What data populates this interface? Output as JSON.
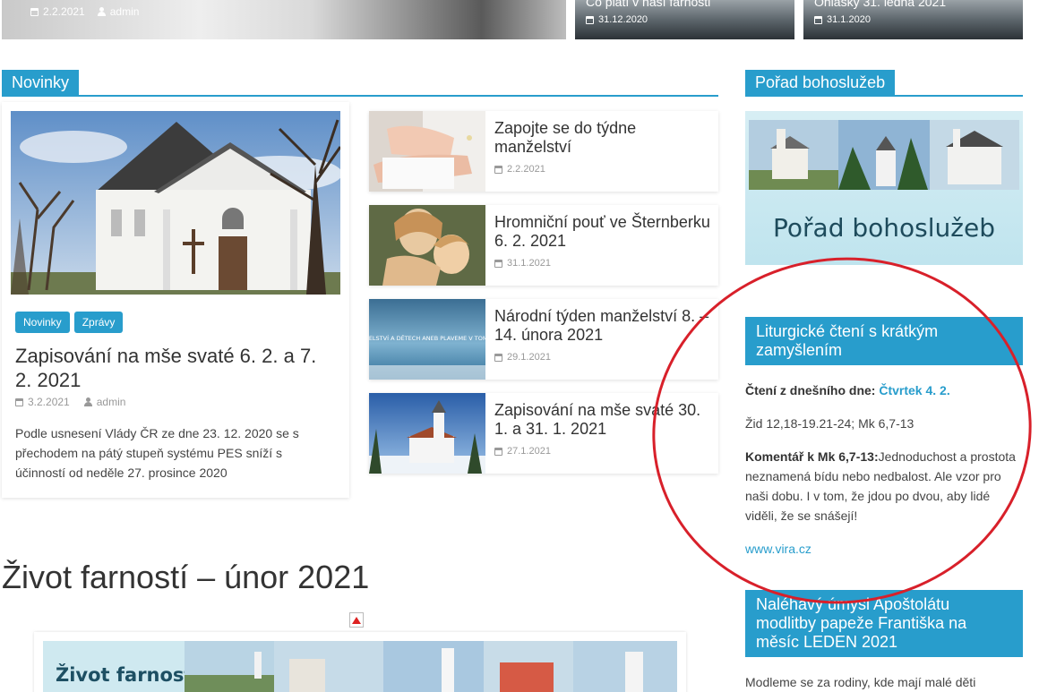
{
  "top_strip": {
    "hero": {
      "date": "2.2.2021",
      "author": "admin"
    },
    "cards": [
      {
        "title": "Co platí v naší farnosti",
        "date": "31.12.2020"
      },
      {
        "title": "Ohlášky 31. ledna 2021",
        "date": "31.1.2020"
      }
    ]
  },
  "news_section": {
    "heading": "Novinky",
    "featured": {
      "tags": [
        "Novinky",
        "Zprávy"
      ],
      "title": "Zapisování na mše svaté 6. 2. a 7. 2. 2021",
      "date": "3.2.2021",
      "author": "admin",
      "excerpt": "Podle usnesení Vlády ČR ze dne 23. 12. 2020 se s přechodem na pátý stupeň systému PES sníží s účinností od neděle 27. prosince 2020"
    },
    "posts": [
      {
        "title": "Zapojte se do týdne manželství",
        "date": "2.2.2021"
      },
      {
        "title": "Hromniční pouť ve Šternberku 6. 2. 2021",
        "date": "31.1.2021"
      },
      {
        "title": "Národní týden manželství 8. – 14. února 2021",
        "date": "29.1.2021"
      },
      {
        "title": "Zapisování na mše svaté 30. 1. a 31. 1. 2021",
        "date": "27.1.2021"
      }
    ],
    "post3_image_text": "„O MANŽELSTVÍ A DĚTECH ANEB PLAVEME V TOM S VÁMI\""
  },
  "page_title": "Život farností – únor 2021",
  "bulletin_banner_text": "Život farností",
  "sidebar": {
    "services_heading": "Pořad bohoslužeb",
    "services_image_text": "Pořad bohoslužeb",
    "liturgy": {
      "heading": "Liturgické čtení s krátkým zamyšlením",
      "today_label": "Čtení z dnešního dne:",
      "today_link": "Čtvrtek 4. 2.",
      "readings": "Žid 12,18-19.21-24; Mk 6,7-13",
      "comment_label": "Komentář k Mk 6,7-13:",
      "comment_text": "Jednoduchost a prostota neznamená bídu nebo nedbalost. Ale vzor pro naši dobu. I v tom, že jdou po dvou, aby lidé viděli, že se snášejí!",
      "source_link": "www.vira.cz"
    },
    "prayer": {
      "heading": "Naléhavý úmysl Apoštolátu modlitby papeže Františka na měsíc LEDEN 2021",
      "text": "Modleme se za rodiny, kde mají malé děti"
    }
  },
  "colors": {
    "accent": "#289dcc",
    "annotation": "#d8202a"
  }
}
